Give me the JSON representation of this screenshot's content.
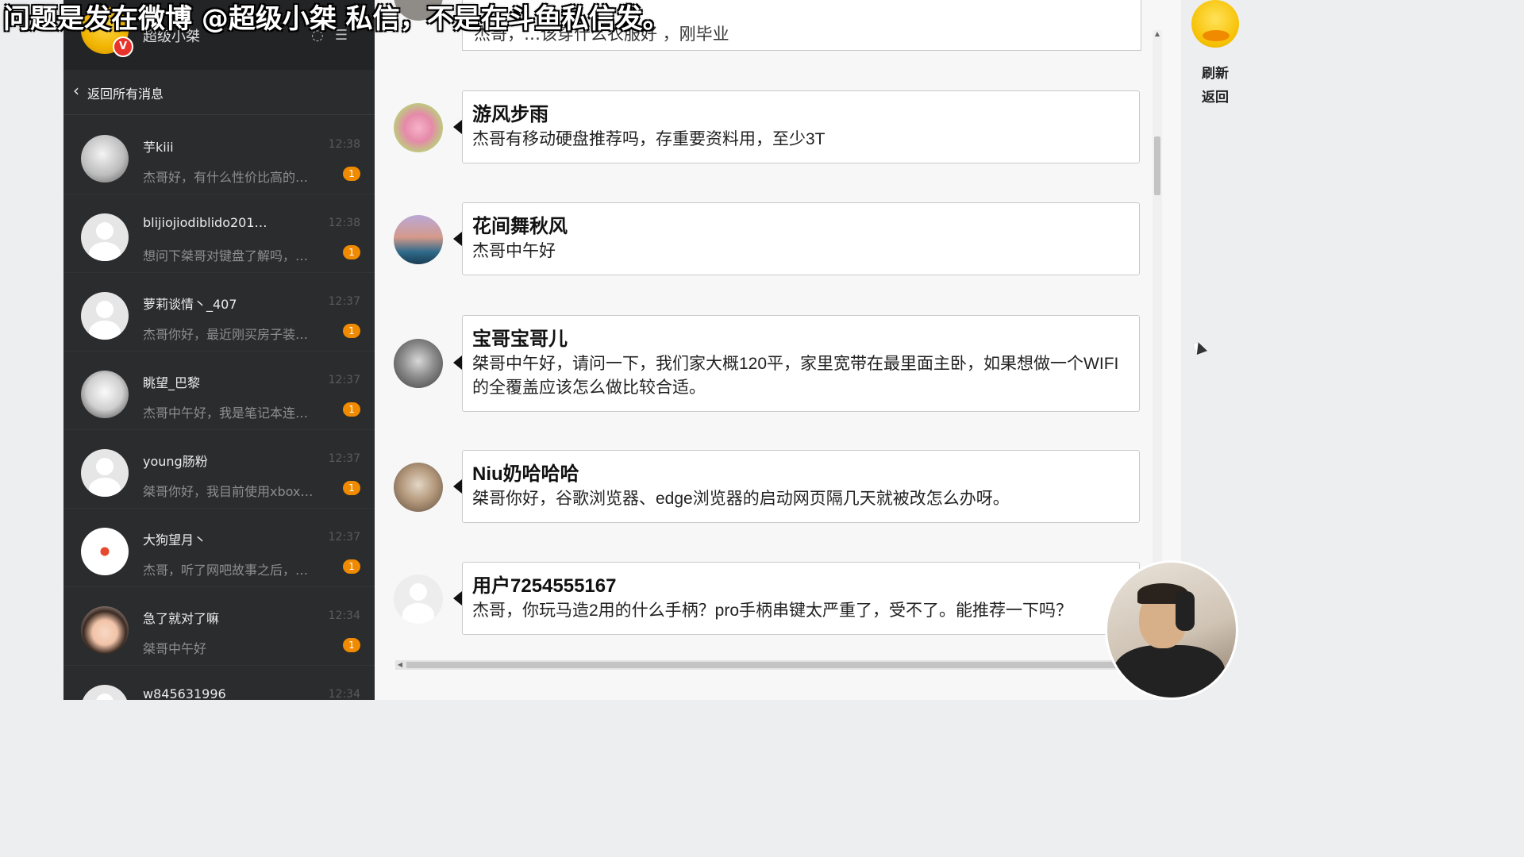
{
  "overlay": {
    "caption": "问题是发在微博 @超级小桀 私信，不是在斗鱼私信发。"
  },
  "sidebar": {
    "user_name": "超级小桀",
    "back_label": "返回所有消息",
    "conversations": [
      {
        "name": "芋kiii",
        "time": "12:38",
        "preview": "杰哥好，有什么性价比高的…",
        "badge": "1"
      },
      {
        "name": "blijiojiodiblido201…",
        "time": "12:38",
        "preview": "想问下桀哥对键盘了解吗，…",
        "badge": "1"
      },
      {
        "name": "萝莉谈情丶_407",
        "time": "12:37",
        "preview": "杰哥你好，最近刚买房子装…",
        "badge": "1"
      },
      {
        "name": "眺望_巴黎",
        "time": "12:37",
        "preview": "杰哥中午好，我是笔记本连…",
        "badge": "1"
      },
      {
        "name": "young肠粉",
        "time": "12:37",
        "preview": "桀哥你好，我目前使用xbox…",
        "badge": "1"
      },
      {
        "name": "大狗望月丶",
        "time": "12:37",
        "preview": "杰哥，听了网吧故事之后，…",
        "badge": "1"
      },
      {
        "name": "急了就对了嘛",
        "time": "12:34",
        "preview": "桀哥中午好",
        "badge": "1"
      },
      {
        "name": "w845631996",
        "time": "12:34",
        "preview": "",
        "badge": ""
      }
    ]
  },
  "chat": {
    "partial_top_text": "杰哥，…该穿什么衣服好 ，刚毕业",
    "messages": [
      {
        "sender": "游风步雨",
        "text": "杰哥有移动硬盘推荐吗，存重要资料用，至少3T"
      },
      {
        "sender": "花间舞秋风",
        "text": "杰哥中午好"
      },
      {
        "sender": "宝哥宝哥儿",
        "text": "桀哥中午好，请问一下，我们家大概120平，家里宽带在最里面主卧，如果想做一个WIFI的全覆盖应该怎么做比较合适。"
      },
      {
        "sender": "Niu奶哈哈哈",
        "text": "桀哥你好，谷歌浏览器、edge浏览器的启动网页隔几天就被改怎么办呀。"
      },
      {
        "sender": "用户7254555167",
        "text": "杰哥，你玩马造2用的什么手柄？pro手柄串键太严重了，受不了。能推荐一下吗？"
      }
    ]
  },
  "right_panel": {
    "refresh_label": "刷新",
    "return_label": "返回"
  },
  "colors": {
    "sidebar_bg": "#2b2c2e",
    "badge_orange": "#f08a00",
    "chat_bg": "#f7f7f7"
  }
}
